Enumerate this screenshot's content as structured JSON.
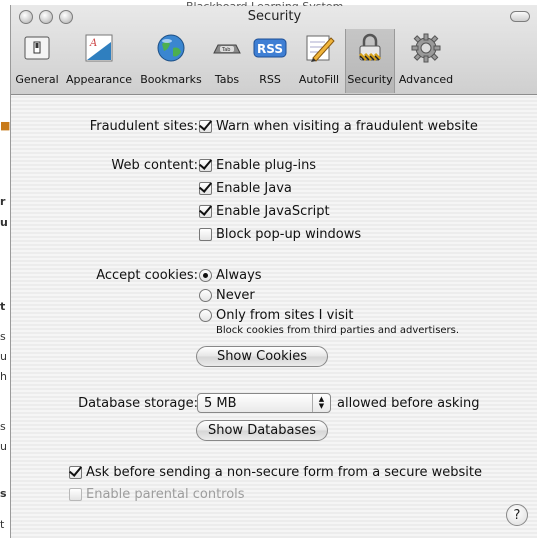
{
  "window": {
    "title": "Security",
    "bg_title": "Blackboard Learning System"
  },
  "toolbar": {
    "items": [
      {
        "label": "General",
        "icon": "switch-icon"
      },
      {
        "label": "Appearance",
        "icon": "font-icon"
      },
      {
        "label": "Bookmarks",
        "icon": "globe-icon"
      },
      {
        "label": "Tabs",
        "icon": "tabs-icon"
      },
      {
        "label": "RSS",
        "icon": "rss-icon"
      },
      {
        "label": "AutoFill",
        "icon": "pencil-icon"
      },
      {
        "label": "Security",
        "icon": "lock-icon",
        "selected": true
      },
      {
        "label": "Advanced",
        "icon": "gear-icon"
      }
    ]
  },
  "security": {
    "fraudulent_label": "Fraudulent sites:",
    "fraudulent_check": "Warn when visiting a fraudulent website",
    "web_content_label": "Web content:",
    "plugins": "Enable plug-ins",
    "java": "Enable Java",
    "javascript": "Enable JavaScript",
    "popups": "Block pop-up windows",
    "cookies_label": "Accept cookies:",
    "cookie_always": "Always",
    "cookie_never": "Never",
    "cookie_visit": "Only from sites I visit",
    "cookie_note": "Block cookies from third parties and advertisers.",
    "show_cookies": "Show Cookies",
    "db_label": "Database storage:",
    "db_value": "5 MB",
    "db_suffix": "allowed before asking",
    "show_databases": "Show Databases",
    "ask_nonsecure": "Ask before sending a non-secure form from a secure website",
    "parental": "Enable parental controls",
    "help": "?"
  },
  "bg_marks": [
    "r",
    "u",
    "t",
    "s",
    "u",
    "h",
    "s",
    "u",
    "s",
    "t"
  ],
  "accent": "#3478c8"
}
